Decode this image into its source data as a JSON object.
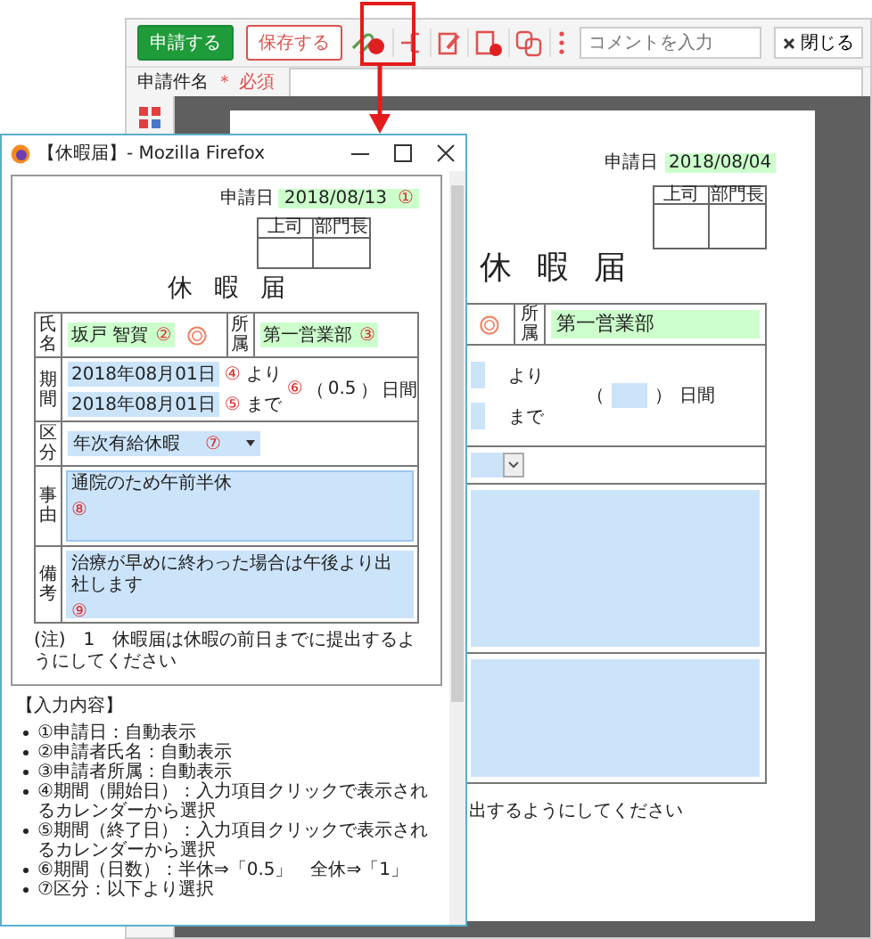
{
  "app": {
    "toolbar": {
      "buttons": [
        {
          "label": "申請する",
          "kind": "primary"
        },
        {
          "label": "保存する",
          "kind": "outline"
        }
      ],
      "comment_field": {
        "placeholder": "コメントを入力"
      },
      "close_button": "閉じる"
    },
    "subject_row": {
      "label": "申請件名",
      "required": "＊ 必須"
    },
    "document": {
      "date_label": "申請日",
      "date": "2018/08/04",
      "approvers": [
        "上司",
        "部門長"
      ],
      "title": "休暇届",
      "affiliation_label": "所属",
      "affiliation": "第一営業部",
      "from_suffix": "より",
      "to_suffix": "まで",
      "days_open": "（",
      "days_close": "）",
      "days_unit": "日間",
      "note": "出するようにしてください"
    }
  },
  "popup": {
    "title": "【休暇届】- Mozilla Firefox",
    "form": {
      "date_label": "申請日",
      "date": "2018/08/13",
      "date_marker": "①",
      "approvers": [
        "上司",
        "部門長"
      ],
      "title": "休暇届",
      "name_label": "氏名",
      "name": "坂戸 智賀",
      "name_marker": "②",
      "affiliation_label": "所属",
      "affiliation": "第一営業部",
      "affiliation_marker": "③",
      "period_label": "期間",
      "start_date": "2018年08月01日",
      "start_marker": "④",
      "from_suffix": "より",
      "end_date": "2018年08月01日",
      "end_marker": "⑤",
      "to_suffix": "まで",
      "days_marker": "⑥",
      "days_open": "（",
      "days": "0.5",
      "days_close": "）",
      "days_unit": "日間",
      "category_label": "区分",
      "category": "年次有給休暇",
      "category_marker": "⑦",
      "reason_label": "事由",
      "reason": "通院のため午前半休",
      "reason_marker": "⑧",
      "remarks_label": "備考",
      "remarks": "治療が早めに終わった場合は午後より出社します",
      "remarks_marker": "⑨",
      "note": "(注)　1　休暇届は休暇の前日までに提出するようにしてください"
    },
    "instructions": {
      "heading": "【入力内容】",
      "items": [
        "①申請日：自動表示",
        "②申請者氏名：自動表示",
        "③申請者所属：自動表示",
        "④期間（開始日）：入力項目クリックで表示されるカレンダーから選択",
        "⑤期間（終了日）：入力項目クリックで表示されるカレンダーから選択",
        "⑥期間（日数）：半休⇒「0.5」　全休⇒「1」",
        "⑦区分：以下より選択"
      ]
    }
  }
}
